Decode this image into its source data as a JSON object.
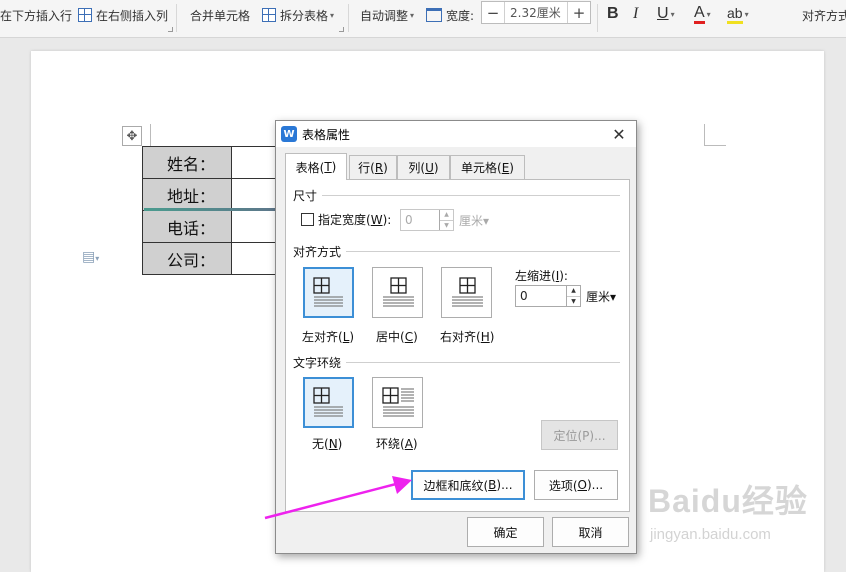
{
  "ribbon": {
    "insert_below": "在下方插入行",
    "insert_right": "在右侧插入列",
    "merge_cells": "合并单元格",
    "split_table": "拆分表格",
    "auto_fit": "自动调整",
    "width_label": "宽度:",
    "width_value": "2.32厘米",
    "minus": "−",
    "plus": "+",
    "bold": "B",
    "italic": "I",
    "underline": "U",
    "font_color": "A",
    "highlight": "ab",
    "align_mode": "对齐方式"
  },
  "document": {
    "table_rows": [
      "姓名：",
      "地址：",
      "电话：",
      "公司："
    ]
  },
  "dialog": {
    "title": "表格属性",
    "app_icon": "W",
    "close": "✕",
    "tabs": [
      {
        "label": "表格(",
        "key": "T",
        "end": ")"
      },
      {
        "label": "行(",
        "key": "R",
        "end": ")"
      },
      {
        "label": "列(",
        "key": "U",
        "end": ")"
      },
      {
        "label": "单元格(",
        "key": "E",
        "end": ")"
      }
    ],
    "size": {
      "heading": "尺寸",
      "fixed_width_label": "指定宽度(",
      "fixed_width_key": "W",
      "fixed_width_end": "):",
      "width_value": "0",
      "unit": "厘米▾"
    },
    "alignment": {
      "heading": "对齐方式",
      "options": [
        {
          "label": "左对齐(",
          "key": "L",
          "end": ")"
        },
        {
          "label": "居中(",
          "key": "C",
          "end": ")"
        },
        {
          "label": "右对齐(",
          "key": "H",
          "end": ")"
        }
      ],
      "indent_label": "左缩进(",
      "indent_key": "I",
      "indent_end": "):",
      "indent_value": "0",
      "indent_unit": "厘米▾"
    },
    "wrapping": {
      "heading": "文字环绕",
      "options": [
        {
          "label": "无(",
          "key": "N",
          "end": ")"
        },
        {
          "label": "环绕(",
          "key": "A",
          "end": ")"
        }
      ],
      "position_button": "定位(P)..."
    },
    "borders_button": {
      "label": "边框和底纹(",
      "key": "B",
      "end": ")..."
    },
    "options_button": {
      "label": "选项(",
      "key": "O",
      "end": ")..."
    },
    "ok": "确定",
    "cancel": "取消"
  },
  "watermark": {
    "brand": "Baidu经验",
    "url": "jingyan.baidu.com"
  },
  "colors": {
    "accent": "#3c8fd6",
    "arrow": "#ee22ee",
    "header_cell": "#d0d0d0"
  }
}
